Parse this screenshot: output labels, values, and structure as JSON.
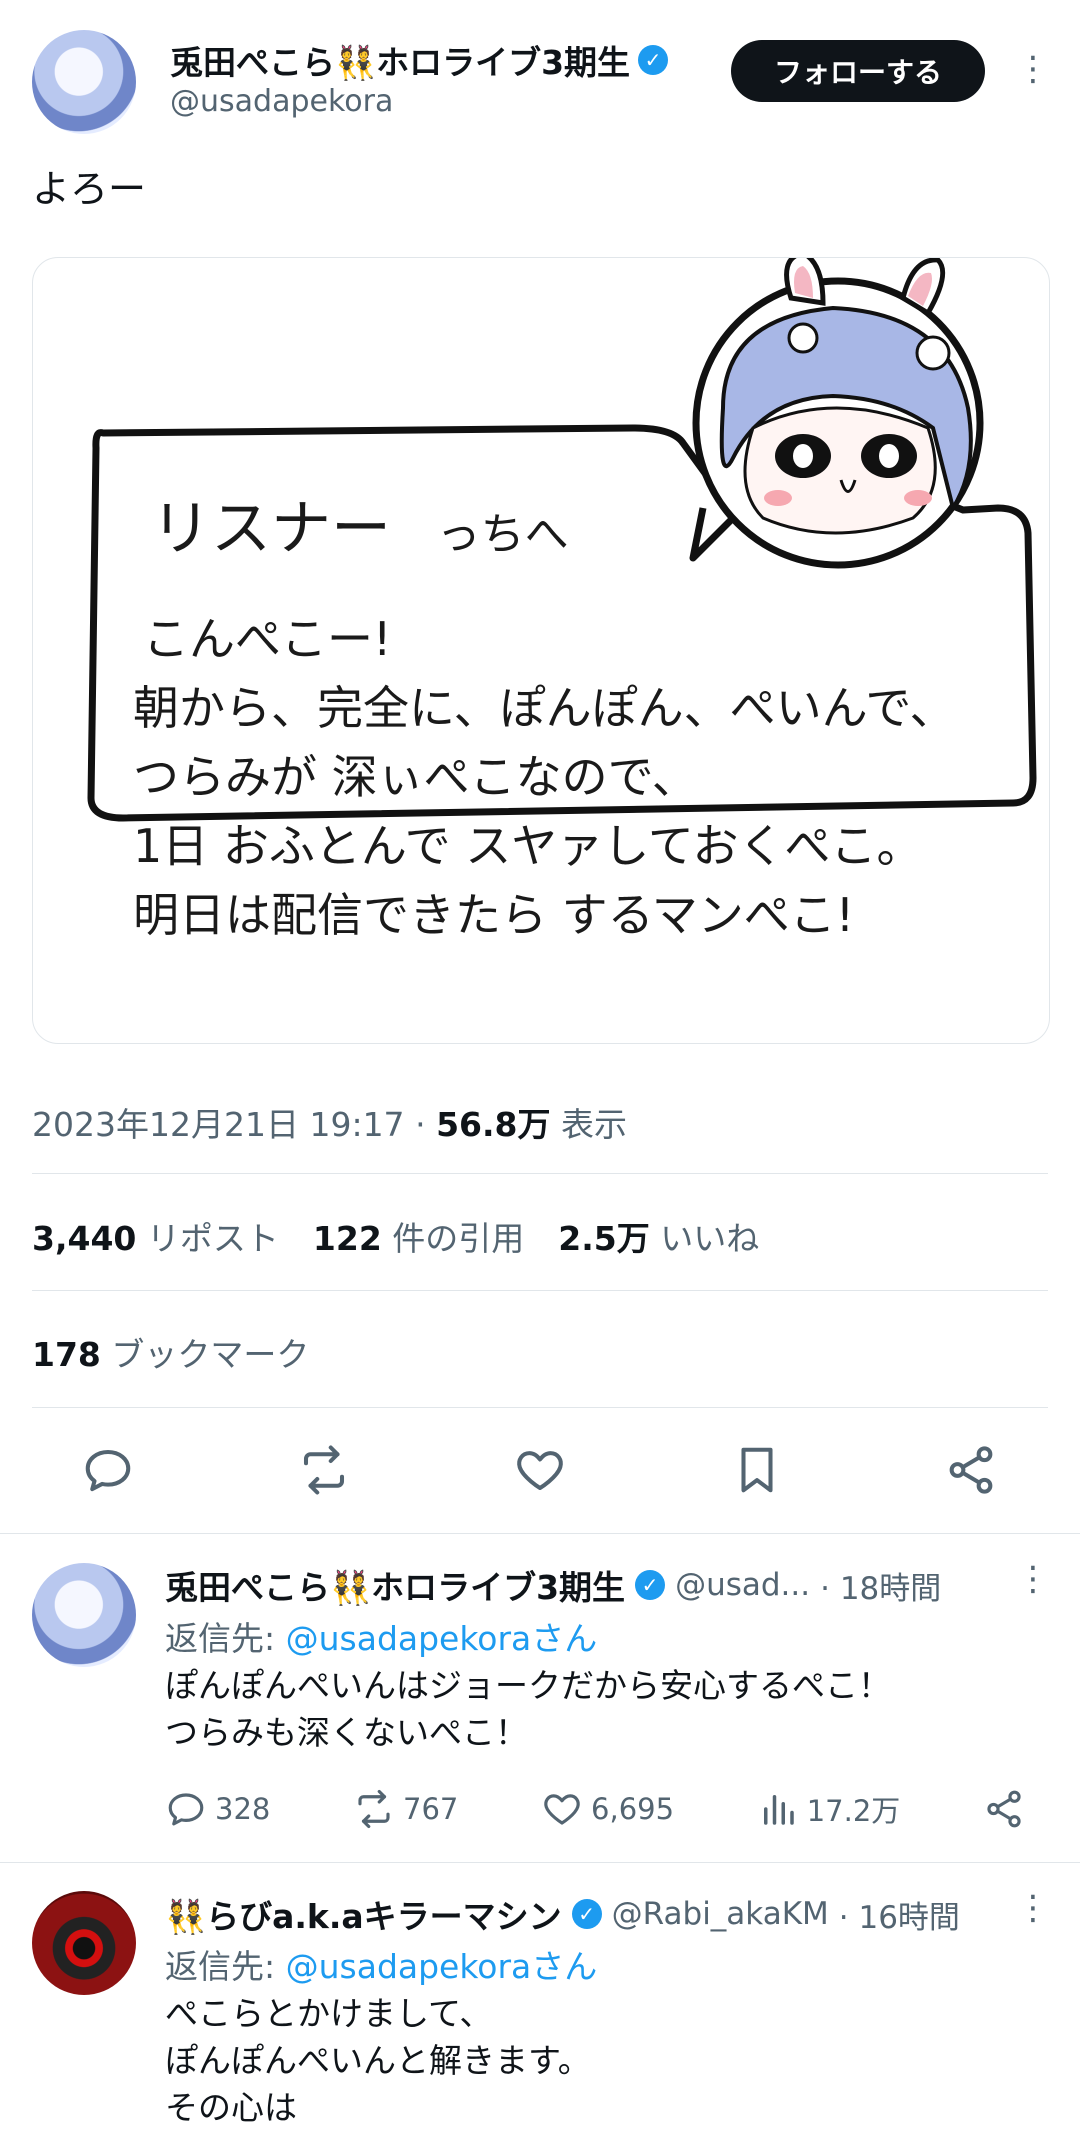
{
  "post": {
    "author_name": "兎田ぺこら👯ホロライブ3期生",
    "author_handle": "@usadapekora",
    "follow_label": "フォローする",
    "text": "よろー",
    "image_letter": {
      "salutation": "リスナー",
      "salutation_suffix": "っちへ",
      "lines": [
        "こんぺこー!",
        "朝から、完全に、ぽんぽん、ぺいんで、",
        "つらみが 深ぃぺこなので、",
        "1日 おふとんで スヤァしておくぺこ。",
        "明日は配信できたら するマンぺこ!"
      ]
    },
    "timestamp": "2023年12月21日 19:17",
    "separator": "·",
    "views_value": "56.8万",
    "views_label": "表示",
    "reposts_value": "3,440",
    "reposts_label": "リポスト",
    "quotes_value": "122",
    "quotes_label": "件の引用",
    "likes_value": "2.5万",
    "likes_label": "いいね",
    "bookmarks_value": "178",
    "bookmarks_label": "ブックマーク"
  },
  "replies": [
    {
      "author_name": "兎田ぺこら👯ホロライブ3期生",
      "author_handle": "@usad...",
      "time": "· 18時間",
      "reply_to_prefix": "返信先: ",
      "reply_to_mention": "@usadapekoraさん",
      "text": "ぽんぽんぺいんはジョークだから安心するぺこ！\nつらみも深くないぺこ！",
      "replies_count": "328",
      "reposts_count": "767",
      "likes_count": "6,695",
      "views_count": "17.2万"
    },
    {
      "author_name": "👯らびa.k.aキラーマシン",
      "author_handle": "@Rabi_akaKM",
      "time": "· 16時間",
      "reply_to_prefix": "返信先: ",
      "reply_to_mention": "@usadapekoraさん",
      "text": "ぺこらとかけまして、\nぽんぽんぺいんと解きます。\nその心は"
    }
  ],
  "colors": {
    "accent": "#1d9bf0",
    "text": "#0f1419",
    "muted": "#536471",
    "divider": "#e1e6ea"
  }
}
